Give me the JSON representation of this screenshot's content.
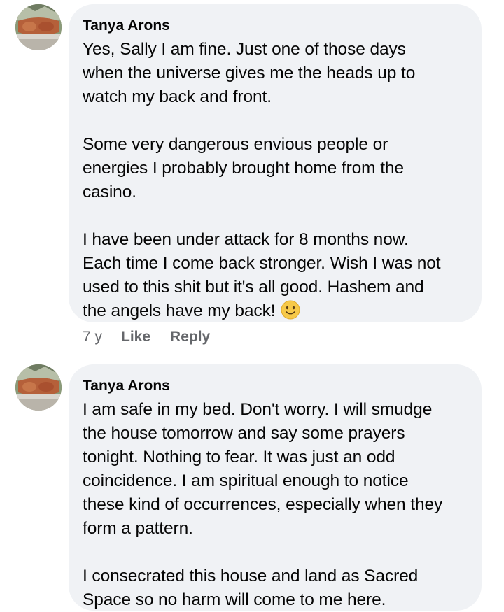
{
  "comments": [
    {
      "author": "Tanya Arons",
      "paragraphs": [
        "Yes, Sally I am fine.  Just one of those days\nwhen the universe gives me the heads up to\nwatch my back and front.",
        "Some very dangerous envious people or\nenergies I probably brought home from the\ncasino.",
        "I have been under attack for 8 months now.\nEach time I come back stronger.  Wish I was not\nused to this shit but it's all good.  Hashem and\nthe angels have my back!"
      ],
      "emoji": "slightly-smiling-face",
      "time": "7 y",
      "like_label": "Like",
      "reply_label": "Reply"
    },
    {
      "author": "Tanya Arons",
      "paragraphs": [
        "I am safe in my bed.  Don't worry.  I will smudge\nthe house tomorrow and say some prayers\ntonight.  Nothing to fear.  It was just an odd\ncoincidence.  I am spiritual enough to notice\nthese kind of occurrences, especially when they\nform a pattern.",
        "I consecrated this house and land as Sacred\nSpace so no harm will come to me here."
      ]
    }
  ],
  "colors": {
    "bubble": "#f0f2f5",
    "meta_text": "#65676b",
    "emoji": "#f7c948"
  }
}
